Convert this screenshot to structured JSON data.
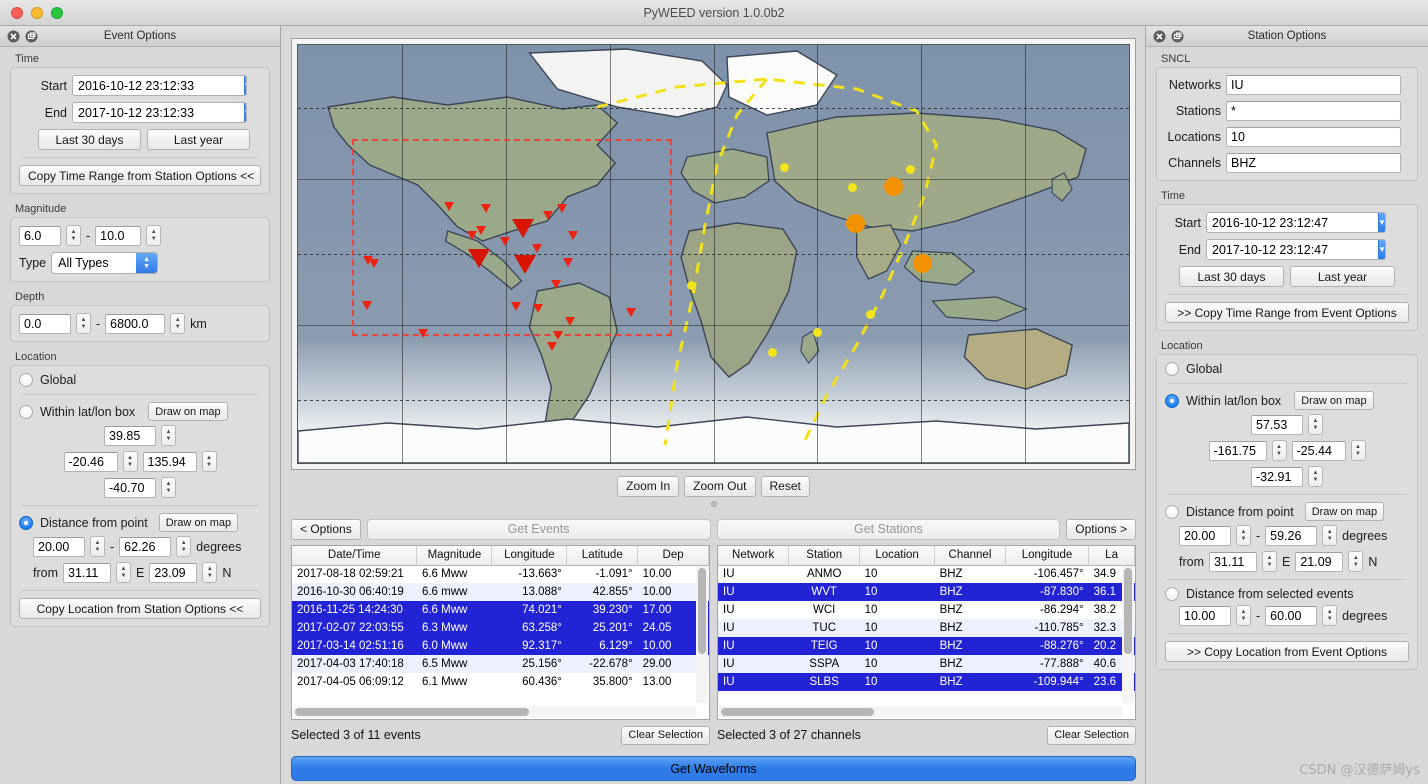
{
  "window": {
    "title": "PyWEED version 1.0.0b2"
  },
  "event_options": {
    "panel_title": "Event Options",
    "time": {
      "group_label": "Time",
      "start_label": "Start",
      "start_value": "2016-10-12 23:12:33",
      "end_label": "End",
      "end_value": "2017-10-12 23:12:33",
      "last30_label": "Last 30 days",
      "lastyear_label": "Last year",
      "copy_label": "Copy Time Range from Station Options <<"
    },
    "magnitude": {
      "group_label": "Magnitude",
      "min": "6.0",
      "max": "10.0",
      "dash": "-",
      "type_label": "Type",
      "type_value": "All Types"
    },
    "depth": {
      "group_label": "Depth",
      "min": "0.0",
      "max": "6800.0",
      "dash": "-",
      "unit": "km"
    },
    "location": {
      "group_label": "Location",
      "global_label": "Global",
      "box_label": "Within lat/lon box",
      "draw_label": "Draw on map",
      "box_north": "39.85",
      "box_west": "-20.46",
      "box_east": "135.94",
      "box_south": "-40.70",
      "point_label": "Distance from point",
      "point_draw_label": "Draw on map",
      "dist_min": "20.00",
      "dist_max": "62.26",
      "dist_dash": "-",
      "degrees_label": "degrees",
      "from_label": "from",
      "lon": "31.11",
      "e_label": "E",
      "lat": "23.09",
      "n_label": "N",
      "copy_label": "Copy Location from Station Options <<"
    }
  },
  "station_options": {
    "panel_title": "Station Options",
    "sncl": {
      "group_label": "SNCL",
      "networks_label": "Networks",
      "networks_value": "IU",
      "stations_label": "Stations",
      "stations_value": "*",
      "locations_label": "Locations",
      "locations_value": "10",
      "channels_label": "Channels",
      "channels_value": "BHZ"
    },
    "time": {
      "group_label": "Time",
      "start_label": "Start",
      "start_value": "2016-10-12 23:12:47",
      "end_label": "End",
      "end_value": "2017-10-12 23:12:47",
      "last30_label": "Last 30 days",
      "lastyear_label": "Last year",
      "copy_label": ">> Copy Time Range from Event Options"
    },
    "location": {
      "group_label": "Location",
      "global_label": "Global",
      "box_label": "Within lat/lon box",
      "draw_label": "Draw on map",
      "box_north": "57.53",
      "box_west": "-161.75",
      "box_east": "-25.44",
      "box_south": "-32.91",
      "point_label": "Distance from point",
      "point_draw_label": "Draw on map",
      "dist_min": "20.00",
      "dist_max": "59.26",
      "dist_dash": "-",
      "degrees_label": "degrees",
      "from_label": "from",
      "lon": "31.11",
      "e_label": "E",
      "lat": "21.09",
      "n_label": "N",
      "events_label": "Distance from selected events",
      "events_min": "10.00",
      "events_max": "60.00",
      "events_dash": "-",
      "events_degrees_label": "degrees",
      "copy_label": ">> Copy Location from Event Options"
    }
  },
  "map": {
    "zoom_in_label": "Zoom In",
    "zoom_out_label": "Zoom Out",
    "reset_label": "Reset"
  },
  "toolbar": {
    "options_left_label": "< Options",
    "get_events_label": "Get Events",
    "get_stations_label": "Get Stations",
    "options_right_label": "Options >"
  },
  "events_table": {
    "columns": [
      "Date/Time",
      "Magnitude",
      "Longitude",
      "Latitude",
      "Dep"
    ],
    "rows": [
      {
        "selected": false,
        "cells": [
          "2017-08-18 02:59:21",
          "6.6 Mww",
          "-13.663°",
          "-1.091°",
          "10.00"
        ]
      },
      {
        "selected": false,
        "cells": [
          "2016-10-30 06:40:19",
          "6.6 mww",
          "13.088°",
          "42.855°",
          "10.00"
        ]
      },
      {
        "selected": true,
        "cells": [
          "2016-11-25 14:24:30",
          "6.6 Mww",
          "74.021°",
          "39.230°",
          "17.00"
        ]
      },
      {
        "selected": true,
        "cells": [
          "2017-02-07 22:03:55",
          "6.3 Mww",
          "63.258°",
          "25.201°",
          "24.05"
        ]
      },
      {
        "selected": true,
        "cells": [
          "2017-03-14 02:51:16",
          "6.0 Mww",
          "92.317°",
          "6.129°",
          "10.00"
        ]
      },
      {
        "selected": false,
        "cells": [
          "2017-04-03 17:40:18",
          "6.5 Mww",
          "25.156°",
          "-22.678°",
          "29.00"
        ]
      },
      {
        "selected": false,
        "cells": [
          "2017-04-05 06:09:12",
          "6.1 Mww",
          "60.436°",
          "35.800°",
          "13.00"
        ]
      }
    ],
    "status": "Selected 3 of 11 events",
    "clear_label": "Clear Selection"
  },
  "stations_table": {
    "columns": [
      "Network",
      "Station",
      "Location",
      "Channel",
      "Longitude",
      "La"
    ],
    "rows": [
      {
        "selected": false,
        "cells": [
          "IU",
          "ANMO",
          "10",
          "BHZ",
          "-106.457°",
          "34.9"
        ]
      },
      {
        "selected": true,
        "cells": [
          "IU",
          "WVT",
          "10",
          "BHZ",
          "-87.830°",
          "36.1"
        ]
      },
      {
        "selected": false,
        "cells": [
          "IU",
          "WCI",
          "10",
          "BHZ",
          "-86.294°",
          "38.2"
        ]
      },
      {
        "selected": false,
        "cells": [
          "IU",
          "TUC",
          "10",
          "BHZ",
          "-110.785°",
          "32.3"
        ]
      },
      {
        "selected": true,
        "cells": [
          "IU",
          "TEIG",
          "10",
          "BHZ",
          "-88.276°",
          "20.2"
        ]
      },
      {
        "selected": false,
        "cells": [
          "IU",
          "SSPA",
          "10",
          "BHZ",
          "-77.888°",
          "40.6"
        ]
      },
      {
        "selected": true,
        "cells": [
          "IU",
          "SLBS",
          "10",
          "BHZ",
          "-109.944°",
          "23.6"
        ]
      }
    ],
    "status": "Selected 3 of 27 channels",
    "clear_label": "Clear Selection"
  },
  "footer": {
    "get_waveforms_label": "Get Waveforms",
    "watermark": "CSDN @汉德萨姆ys"
  },
  "colors": {
    "selection_blue": "#2323d6",
    "accent_blue": "#2f7ce8",
    "event_marker": "#f39200",
    "station_marker": "#ee2211",
    "box_red": "#e8443a",
    "great_circle_yellow": "#f4e41c"
  }
}
